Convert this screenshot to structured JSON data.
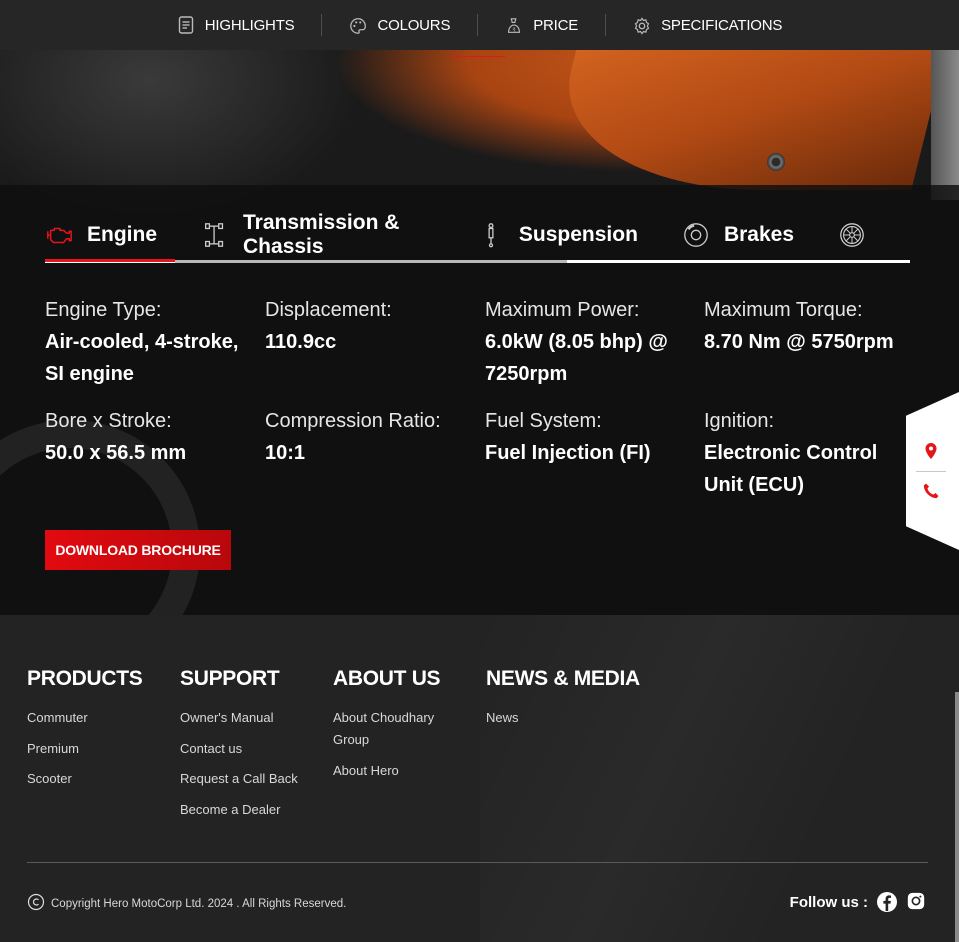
{
  "nav": {
    "items": [
      {
        "label": "HIGHLIGHTS",
        "icon": "document-icon"
      },
      {
        "label": "COLOURS",
        "icon": "palette-icon"
      },
      {
        "label": "PRICE",
        "icon": "price-tag-icon"
      },
      {
        "label": "SPECIFICATIONS",
        "icon": "gear-icon"
      }
    ]
  },
  "spec_tabs": [
    {
      "label": "Engine",
      "icon": "engine-icon",
      "active": true
    },
    {
      "label": "Transmission & Chassis",
      "icon": "chassis-icon",
      "active": false
    },
    {
      "label": "Suspension",
      "icon": "suspension-icon",
      "active": false
    },
    {
      "label": "Brakes",
      "icon": "brake-disc-icon",
      "active": false
    },
    {
      "label": "",
      "icon": "wheel-icon",
      "active": false
    }
  ],
  "specs": [
    {
      "label": "Engine Type:",
      "value": "Air-cooled, 4-stroke, SI engine"
    },
    {
      "label": "Displacement:",
      "value": "110.9cc"
    },
    {
      "label": "Maximum Power:",
      "value": "6.0kW (8.05 bhp) @ 7250rpm"
    },
    {
      "label": "Maximum Torque:",
      "value": "8.70 Nm @ 5750rpm"
    },
    {
      "label": "Bore x Stroke:",
      "value": "50.0 x 56.5 mm"
    },
    {
      "label": "Compression Ratio:",
      "value": "10:1"
    },
    {
      "label": "Fuel System:",
      "value": "Fuel Injection (FI)"
    },
    {
      "label": "Ignition:",
      "value": "Electronic Control Unit (ECU)"
    }
  ],
  "download_brochure": "DOWNLOAD BROCHURE",
  "side_float": {
    "icons": [
      "location-pin-icon",
      "phone-icon"
    ]
  },
  "footer": {
    "columns": [
      {
        "heading": "PRODUCTS",
        "links": [
          "Commuter",
          "Premium",
          "Scooter"
        ]
      },
      {
        "heading": "SUPPORT",
        "links": [
          "Owner's Manual",
          "Contact us",
          "Request a Call Back",
          "Become a Dealer"
        ]
      },
      {
        "heading": "ABOUT US",
        "links": [
          "About Choudhary Group",
          "About Hero"
        ]
      },
      {
        "heading": "NEWS & MEDIA",
        "links": [
          "News"
        ]
      }
    ],
    "copyright": "Copyright Hero MotoCorp Ltd. 2024 . All Rights Reserved.",
    "follow_label": "Follow us :",
    "social_icons": [
      "facebook-icon",
      "instagram-icon"
    ]
  },
  "colors": {
    "accent": "#e4151b",
    "background": "#232323",
    "nav_bg": "#262626"
  }
}
